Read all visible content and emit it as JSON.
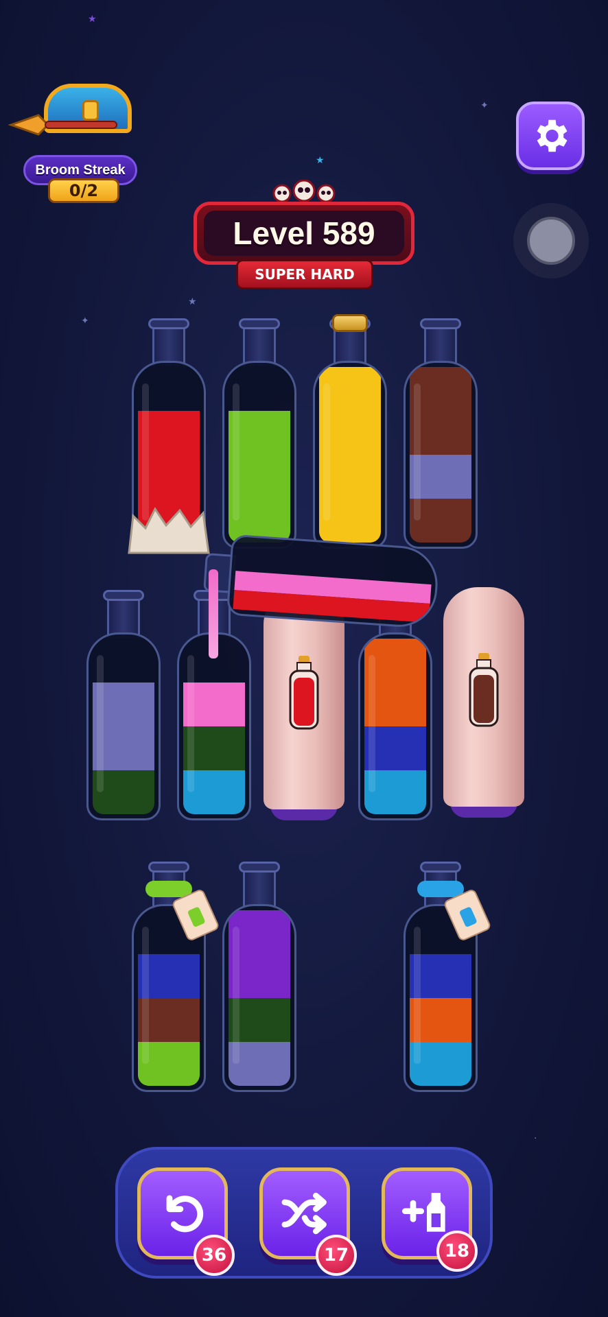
{
  "streak": {
    "label": "Broom Streak",
    "count": "0/2"
  },
  "level": {
    "title": "Level 589",
    "difficulty": "SUPER HARD"
  },
  "colors": {
    "red": "#dc1520",
    "lime": "#6fc222",
    "yellow": "#f5c416",
    "brown": "#6b2d22",
    "lavender": "#6e6eb6",
    "darkgreen": "#1f4a1a",
    "pink": "#f36bcb",
    "cyan": "#1d9bd5",
    "orange": "#e45512",
    "blue": "#2630b4",
    "purple": "#7a26c8"
  },
  "bottles": [
    {
      "id": "b1",
      "layers": [
        "red",
        "red",
        "red"
      ],
      "cap": "none",
      "base": "crown"
    },
    {
      "id": "b2",
      "layers": [
        "lime",
        "lime",
        "lime"
      ],
      "cap": "none"
    },
    {
      "id": "b3",
      "layers": [
        "yellow",
        "yellow",
        "yellow",
        "yellow"
      ],
      "cap": "cork"
    },
    {
      "id": "b4",
      "layers": [
        "brown",
        "lavender",
        "brown",
        "brown"
      ],
      "cap": "none"
    },
    {
      "id": "b5",
      "layers": [
        "darkgreen",
        "lavender",
        "lavender"
      ],
      "cap": "none"
    },
    {
      "id": "b6",
      "layers": [
        "cyan",
        "darkgreen",
        "pink"
      ],
      "cap": "none"
    },
    {
      "id": "b7",
      "covered": true,
      "hint": "red"
    },
    {
      "id": "b8",
      "layers": [
        "cyan",
        "blue",
        "orange",
        "orange"
      ],
      "cap": "none"
    },
    {
      "id": "b9",
      "covered": true,
      "hint": "brown"
    },
    {
      "id": "b10",
      "layers": [
        "lime",
        "brown",
        "blue"
      ],
      "cap": "rope-green"
    },
    {
      "id": "b11",
      "layers": [
        "lavender",
        "darkgreen",
        "purple",
        "purple"
      ],
      "cap": "none"
    },
    {
      "id": "b12",
      "layers": [
        "cyan",
        "orange",
        "blue"
      ],
      "cap": "rope-blue"
    }
  ],
  "pouring": {
    "layers": [
      "red",
      "pink"
    ]
  },
  "tools": [
    {
      "name": "undo",
      "count": "36"
    },
    {
      "name": "shuffle",
      "count": "17"
    },
    {
      "name": "add-bottle",
      "count": "18"
    }
  ]
}
